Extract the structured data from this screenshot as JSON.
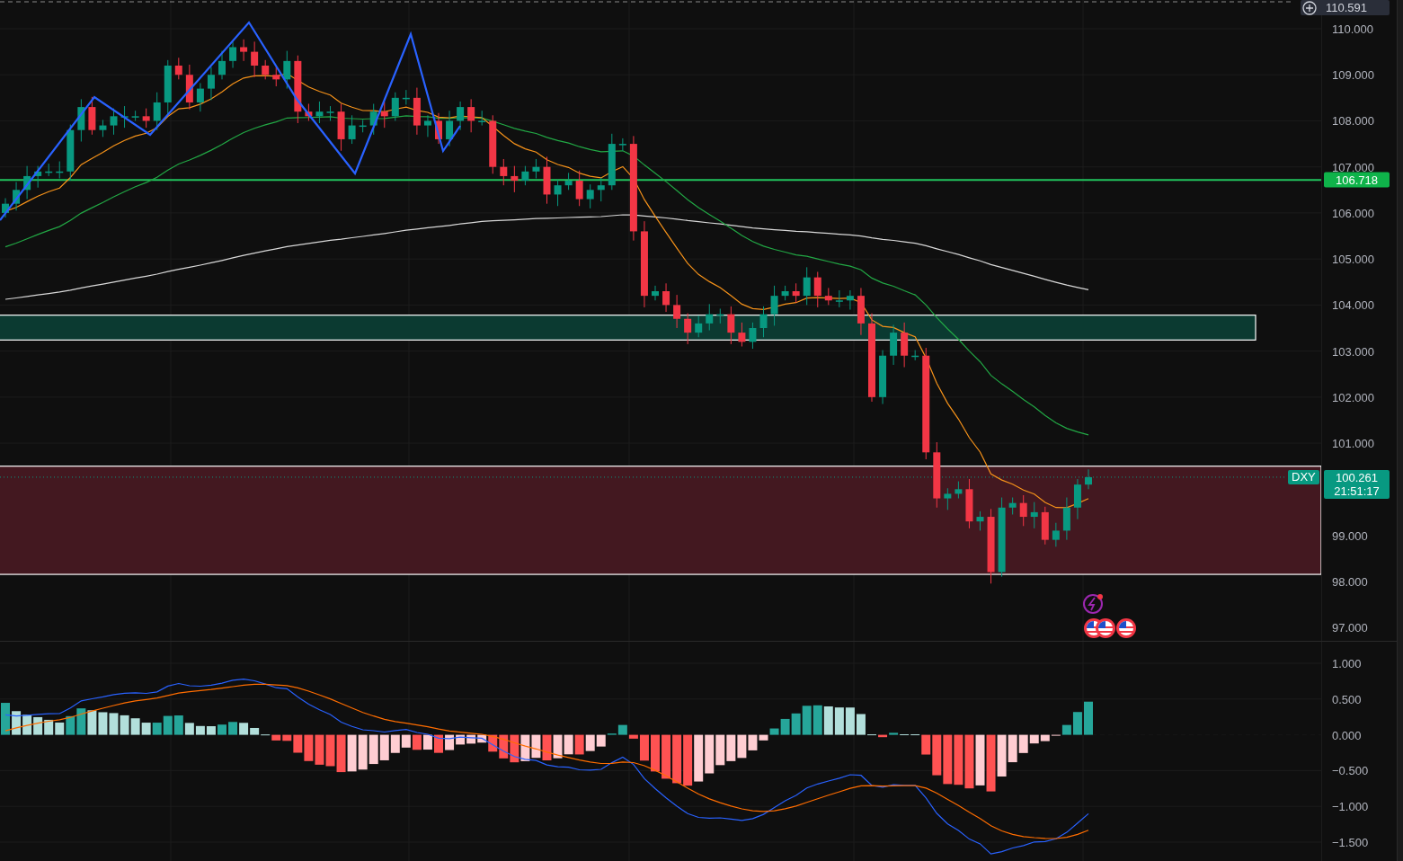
{
  "price_axis": {
    "ticks": [
      "110.000",
      "109.000",
      "108.000",
      "107.000",
      "106.000",
      "105.000",
      "104.000",
      "103.000",
      "102.000",
      "101.000"
    ],
    "lower_ticks": [
      "99.000",
      "98.000",
      "97.000"
    ],
    "high_badge": "110.591",
    "level_badge": "106.718",
    "current": {
      "symbol": "DXY",
      "price": "100.261",
      "countdown": "21:51:17"
    }
  },
  "macd_axis": {
    "ticks": [
      "1.000",
      "0.500",
      "0.000",
      "−0.500",
      "−1.000",
      "−1.500"
    ]
  }
}
